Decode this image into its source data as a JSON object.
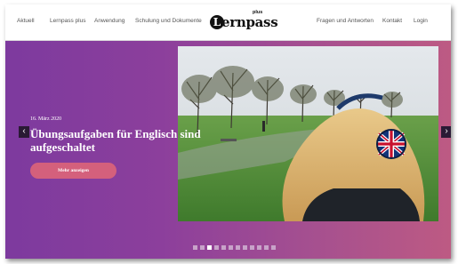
{
  "nav": {
    "items": [
      {
        "label": "Aktuell"
      },
      {
        "label": "Lernpass plus"
      },
      {
        "label": "Anwendung"
      },
      {
        "label": "Schulung und Dokumente"
      },
      {
        "label": "Fragen und Antworten"
      },
      {
        "label": "Kontakt"
      },
      {
        "label": "Login"
      }
    ],
    "logo": {
      "initial": "L",
      "text": "ernpass",
      "plus": "plus"
    }
  },
  "hero": {
    "date": "16. März 2020",
    "headline": "Übungsaufgaben für Englisch sind aufgeschaltet",
    "cta_label": "Mehr anzeigen",
    "prev_label": "‹",
    "next_label": "›",
    "slide_count": 12,
    "active_slide": 3
  },
  "colors": {
    "gradient_start": "#7d3a9e",
    "gradient_end": "#bd5a83",
    "button": "#d4607c"
  },
  "icons": [
    "chevron-left-icon",
    "chevron-right-icon"
  ]
}
